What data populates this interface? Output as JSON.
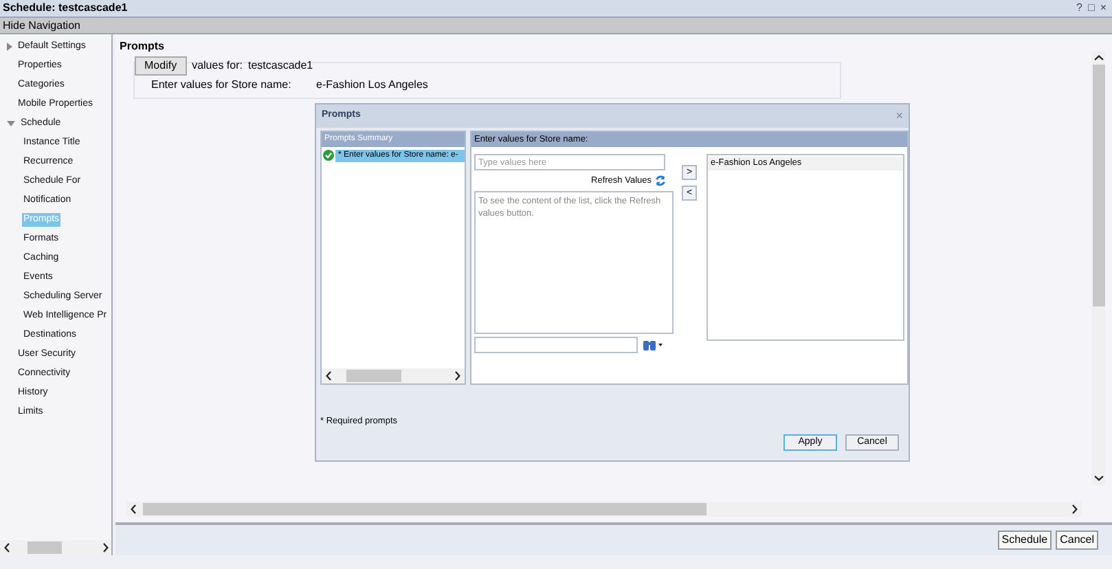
{
  "window": {
    "title": "Schedule: testcascade1",
    "controls": [
      "?",
      "□",
      "×"
    ]
  },
  "nav_toggle": "Hide Navigation",
  "sidebar": {
    "items": [
      {
        "label": "Default Settings",
        "selected": false,
        "expanded": false
      },
      {
        "label": "Properties",
        "selected": false
      },
      {
        "label": "Categories",
        "selected": false
      },
      {
        "label": "Mobile Properties",
        "selected": false
      },
      {
        "label": "Schedule",
        "selected": false,
        "expanded": true,
        "children": [
          {
            "label": "Instance Title",
            "selected": false
          },
          {
            "label": "Recurrence",
            "selected": false
          },
          {
            "label": "Schedule For",
            "selected": false
          },
          {
            "label": "Notification",
            "selected": false
          },
          {
            "label": "Prompts",
            "selected": true
          },
          {
            "label": "Formats",
            "selected": false
          },
          {
            "label": "Caching",
            "selected": false
          },
          {
            "label": "Events",
            "selected": false
          },
          {
            "label": "Scheduling Server",
            "selected": false
          },
          {
            "label": "Web Intelligence Pr",
            "selected": false
          },
          {
            "label": "Destinations",
            "selected": false
          }
        ]
      },
      {
        "label": "User Security",
        "selected": false
      },
      {
        "label": "Connectivity",
        "selected": false
      },
      {
        "label": "History",
        "selected": false
      },
      {
        "label": "Limits",
        "selected": false
      }
    ]
  },
  "content": {
    "heading": "Prompts",
    "modify_button": "Modify",
    "values_for_label": "values for:",
    "values_for_value": "testcascade1",
    "prompt_rows": [
      {
        "label": "Enter values for Store name:",
        "value": "e-Fashion Los Angeles"
      }
    ]
  },
  "dialog": {
    "title": "Prompts",
    "close": "×",
    "summary": {
      "header": "Prompts Summary",
      "items": [
        {
          "label": "* Enter values for Store name: e-",
          "selected": true,
          "complete": true
        }
      ]
    },
    "editor": {
      "header": "Enter values for Store name:",
      "search": {
        "placeholder": "Type values here"
      },
      "refresh": "Refresh Values",
      "list_hint": "To see the content of the list, click the Refresh values button.",
      "add": ">",
      "remove": "<",
      "selected_values": [
        "e-Fashion Los Angeles"
      ]
    },
    "footnote": "* Required prompts",
    "buttons": [
      "Apply",
      "Cancel"
    ]
  },
  "footer": {
    "buttons": [
      "Schedule",
      "Cancel"
    ]
  }
}
